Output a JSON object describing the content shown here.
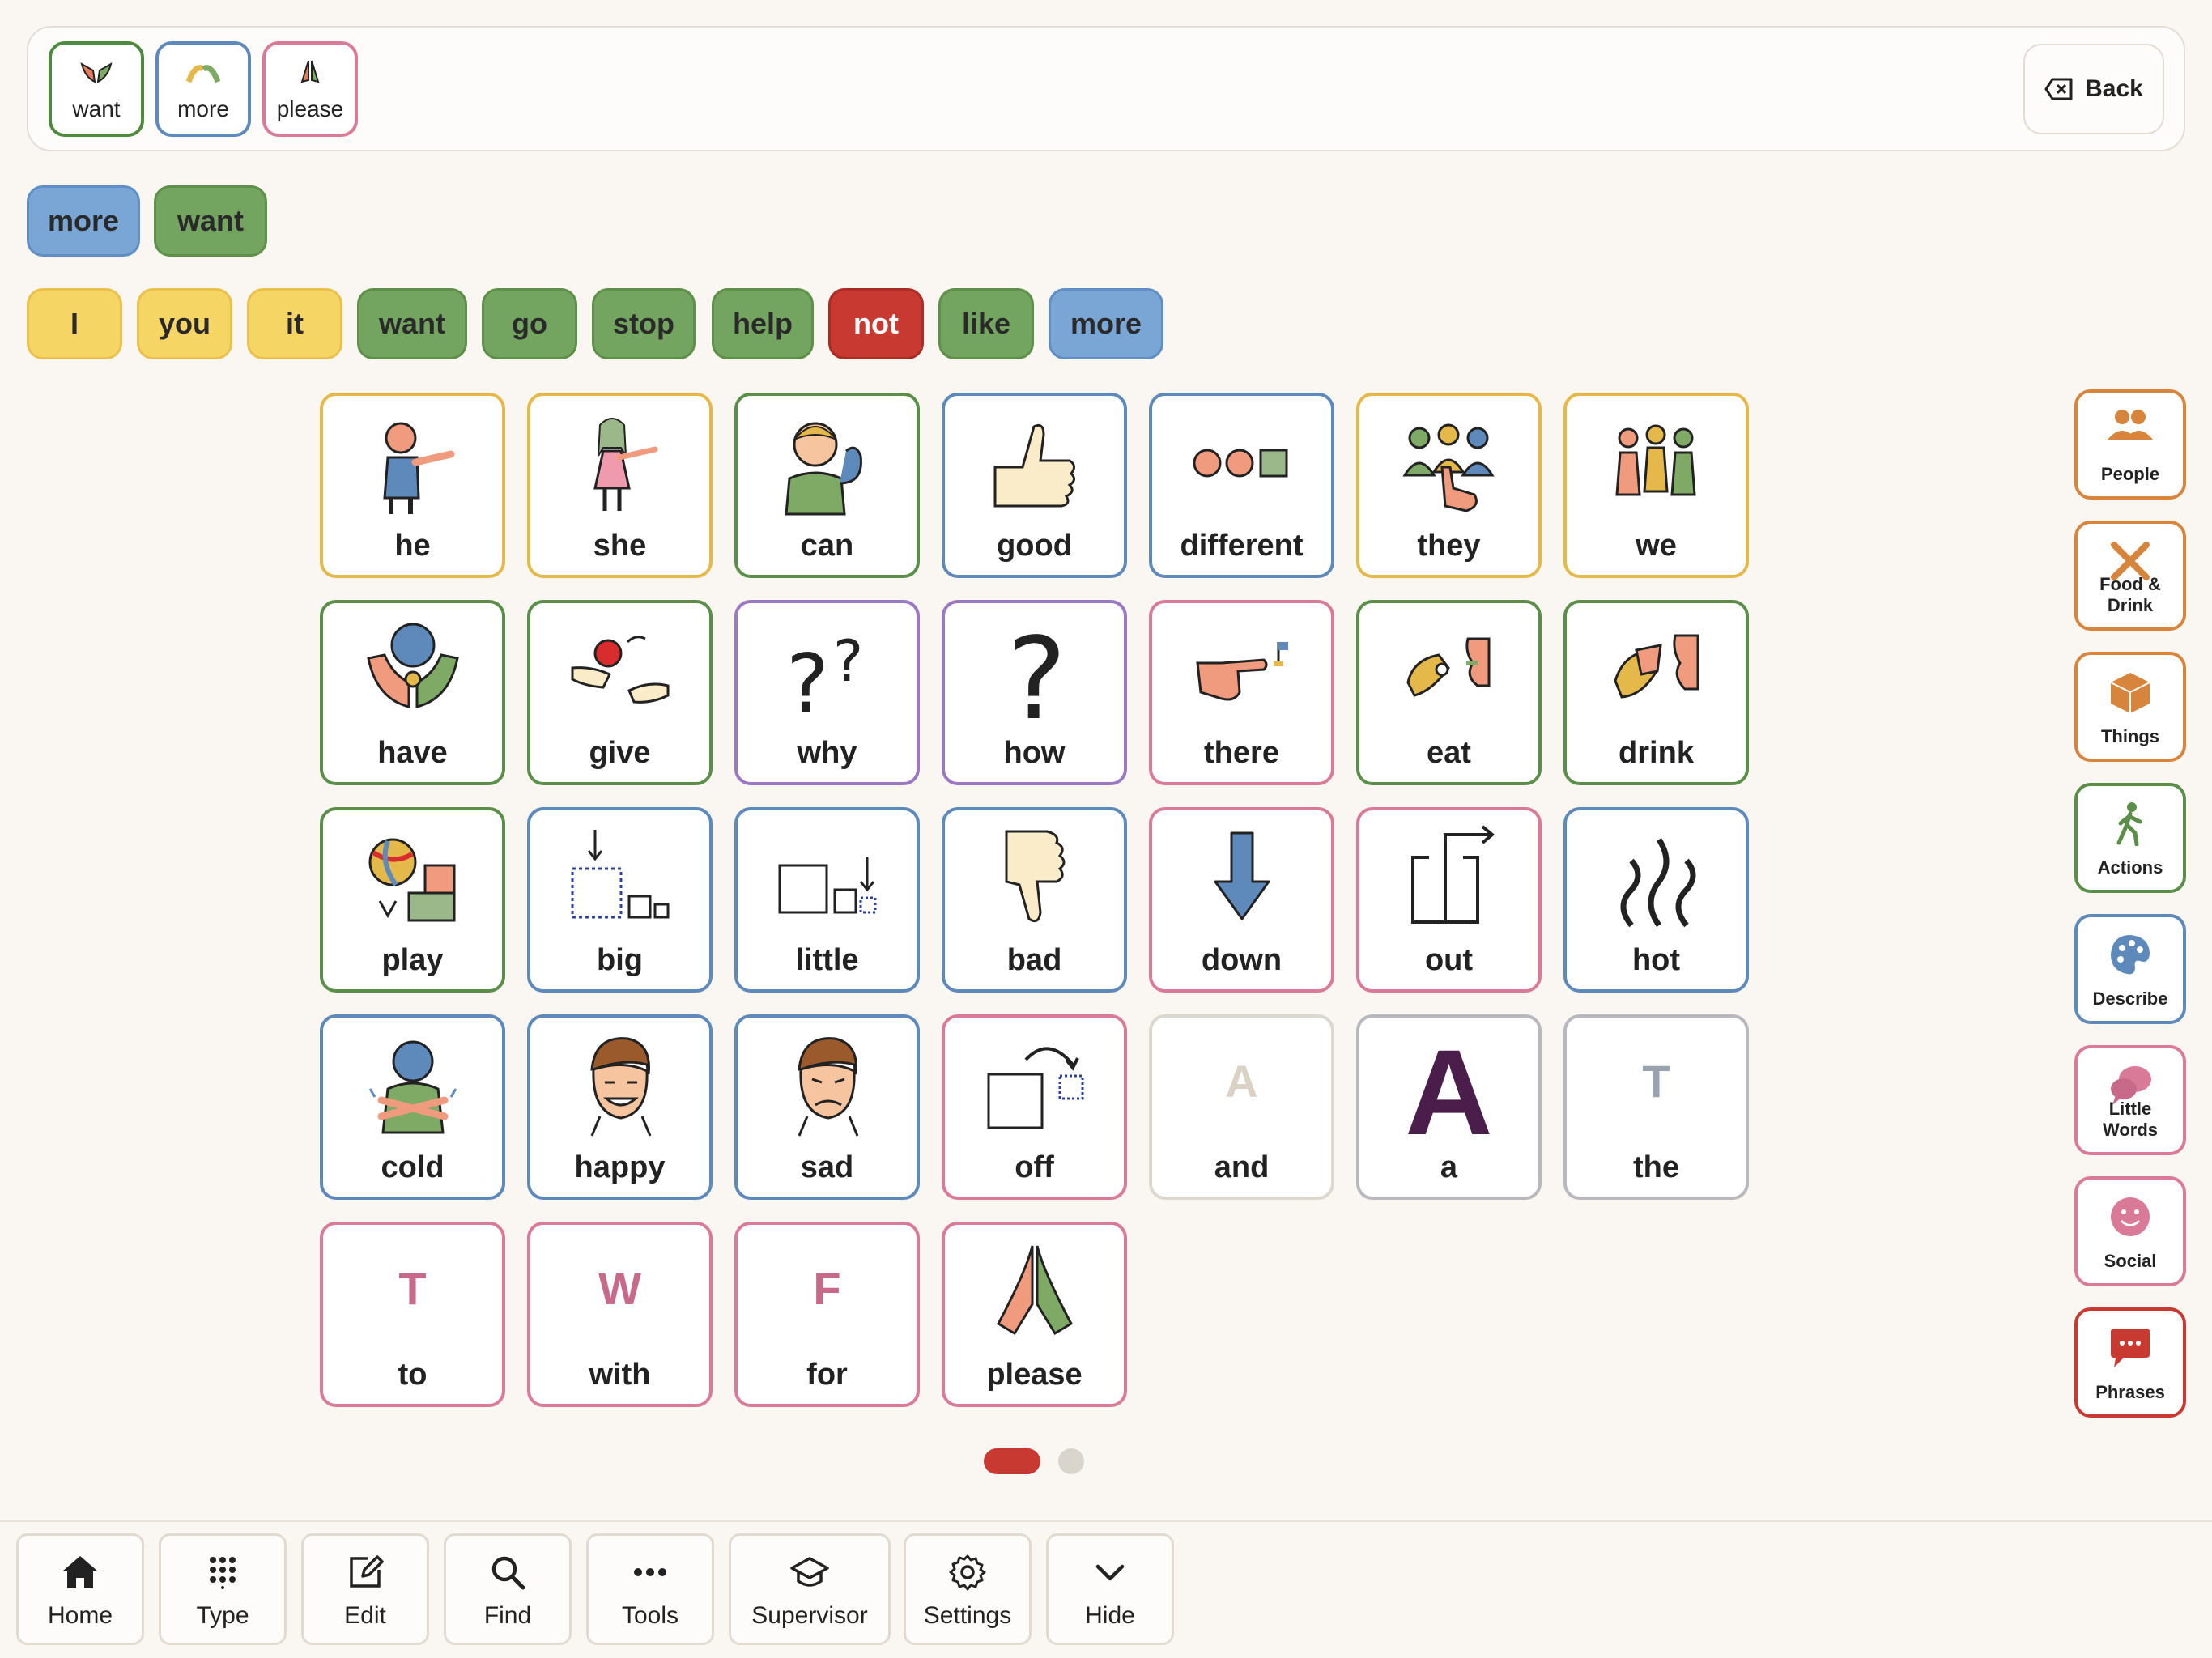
{
  "message_bar": {
    "tiles": [
      {
        "label": "want",
        "border": "#4e8a3e"
      },
      {
        "label": "more",
        "border": "#5d89bb"
      },
      {
        "label": "please",
        "border": "#d97a98"
      }
    ],
    "back_label": "Back"
  },
  "suggestions": [
    "more",
    "want"
  ],
  "quick_words": [
    "I",
    "you",
    "it",
    "want",
    "go",
    "stop",
    "help",
    "not",
    "like",
    "more"
  ],
  "grid": {
    "rows": [
      [
        "he",
        "she",
        "can",
        "good",
        "different",
        "they",
        "we"
      ],
      [
        "have",
        "give",
        "why",
        "how",
        "there",
        "eat",
        "drink"
      ],
      [
        "play",
        "big",
        "little",
        "bad",
        "down",
        "out",
        "hot"
      ],
      [
        "cold",
        "happy",
        "sad",
        "off",
        "and",
        "a",
        "the"
      ],
      [
        "to",
        "with",
        "for",
        "please"
      ]
    ],
    "letters": {
      "and": "A",
      "a": "A",
      "the": "T",
      "to": "T",
      "with": "W",
      "for": "F"
    }
  },
  "pagination": {
    "current": 1,
    "total": 2
  },
  "categories": [
    "People",
    "Food & Drink",
    "Things",
    "Actions",
    "Describe",
    "Little Words",
    "Social",
    "Phrases"
  ],
  "toolbar": [
    "Home",
    "Type",
    "Edit",
    "Find",
    "Tools",
    "Supervisor",
    "Settings",
    "Hide"
  ]
}
